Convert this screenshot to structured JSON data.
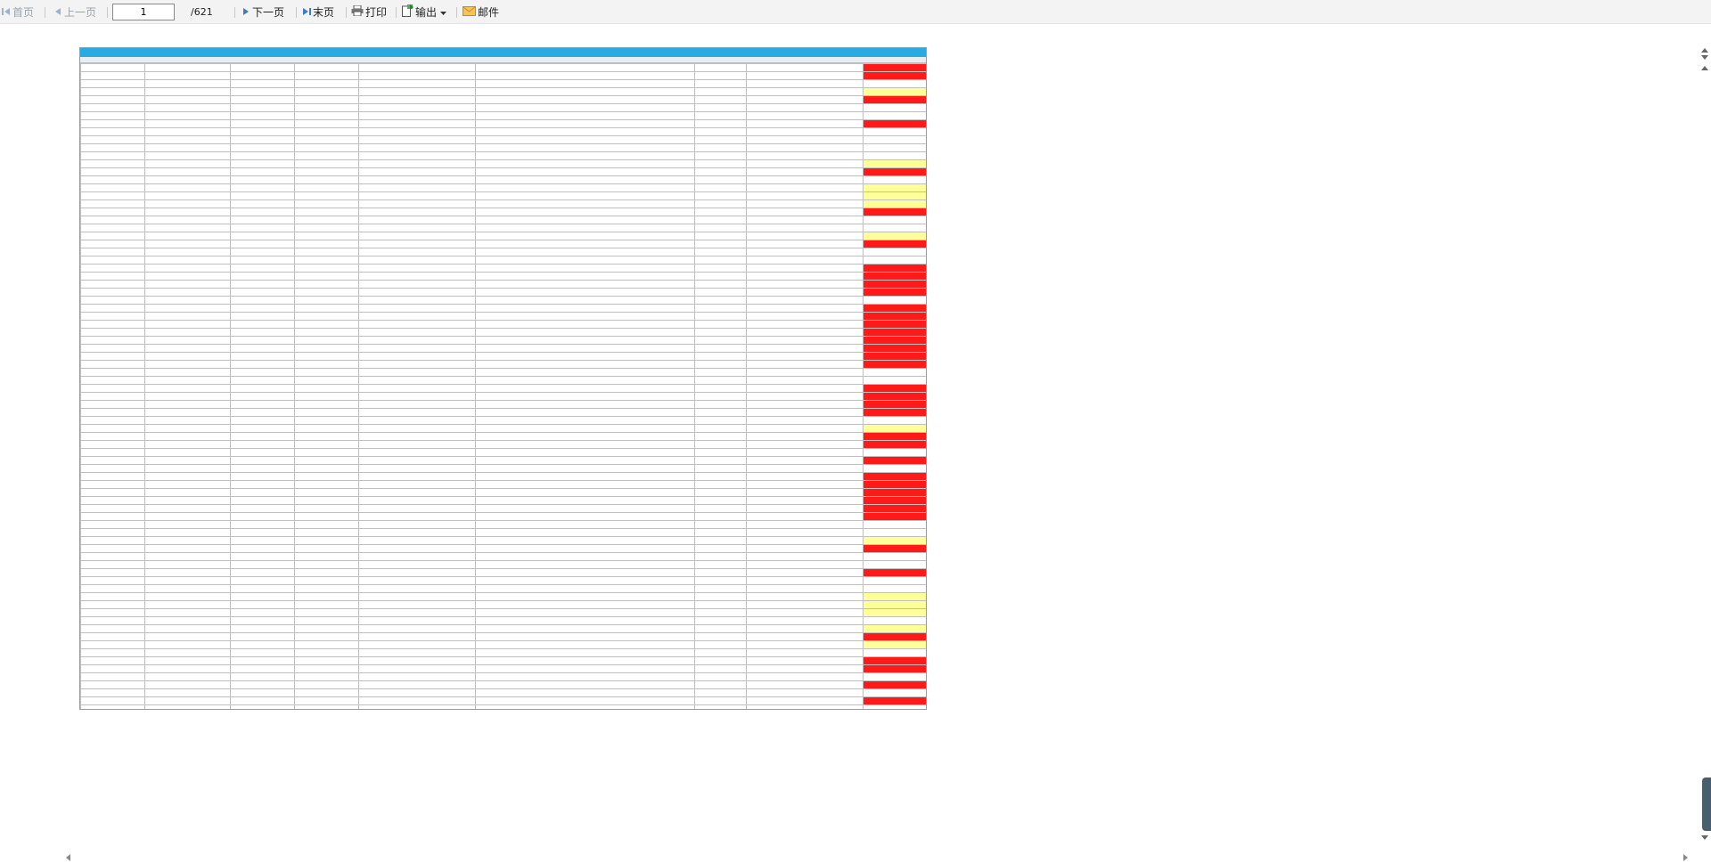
{
  "toolbar": {
    "first_label": "首页",
    "prev_label": "上一页",
    "current_page": "1",
    "total_pages": "/621",
    "next_label": "下一页",
    "last_label": "末页",
    "print_label": "打印",
    "export_label": "输出",
    "mail_label": "邮件"
  },
  "colors": {
    "title_bar": "#29abe2",
    "rate_red": "#ff1a1a",
    "rate_yellow": "#ffff99"
  },
  "report": {
    "row_colors": [
      "red",
      "red",
      "white",
      "yellow",
      "red",
      "white",
      "white",
      "red",
      "white",
      "white",
      "white",
      "white",
      "yellow",
      "red",
      "white",
      "yellow",
      "yellow",
      "yellow",
      "red",
      "white",
      "white",
      "yellow",
      "red",
      "white",
      "white",
      "red",
      "red",
      "red",
      "red",
      "white",
      "red",
      "red",
      "red",
      "red",
      "red",
      "red",
      "red",
      "red",
      "white",
      "white",
      "red",
      "red",
      "red",
      "red",
      "white",
      "yellow",
      "red",
      "red",
      "white",
      "red",
      "white",
      "red",
      "red",
      "red",
      "red",
      "red",
      "red",
      "white",
      "white",
      "yellow",
      "red",
      "white",
      "white",
      "red",
      "white",
      "white",
      "yellow",
      "yellow",
      "yellow",
      "white",
      "yellow",
      "red",
      "yellow",
      "white",
      "red",
      "red",
      "white",
      "red",
      "white",
      "red",
      "white",
      "red",
      "red",
      "red",
      "yellow",
      "white",
      "white",
      "red",
      "yellow",
      "red",
      "white",
      "red",
      "red"
    ]
  }
}
